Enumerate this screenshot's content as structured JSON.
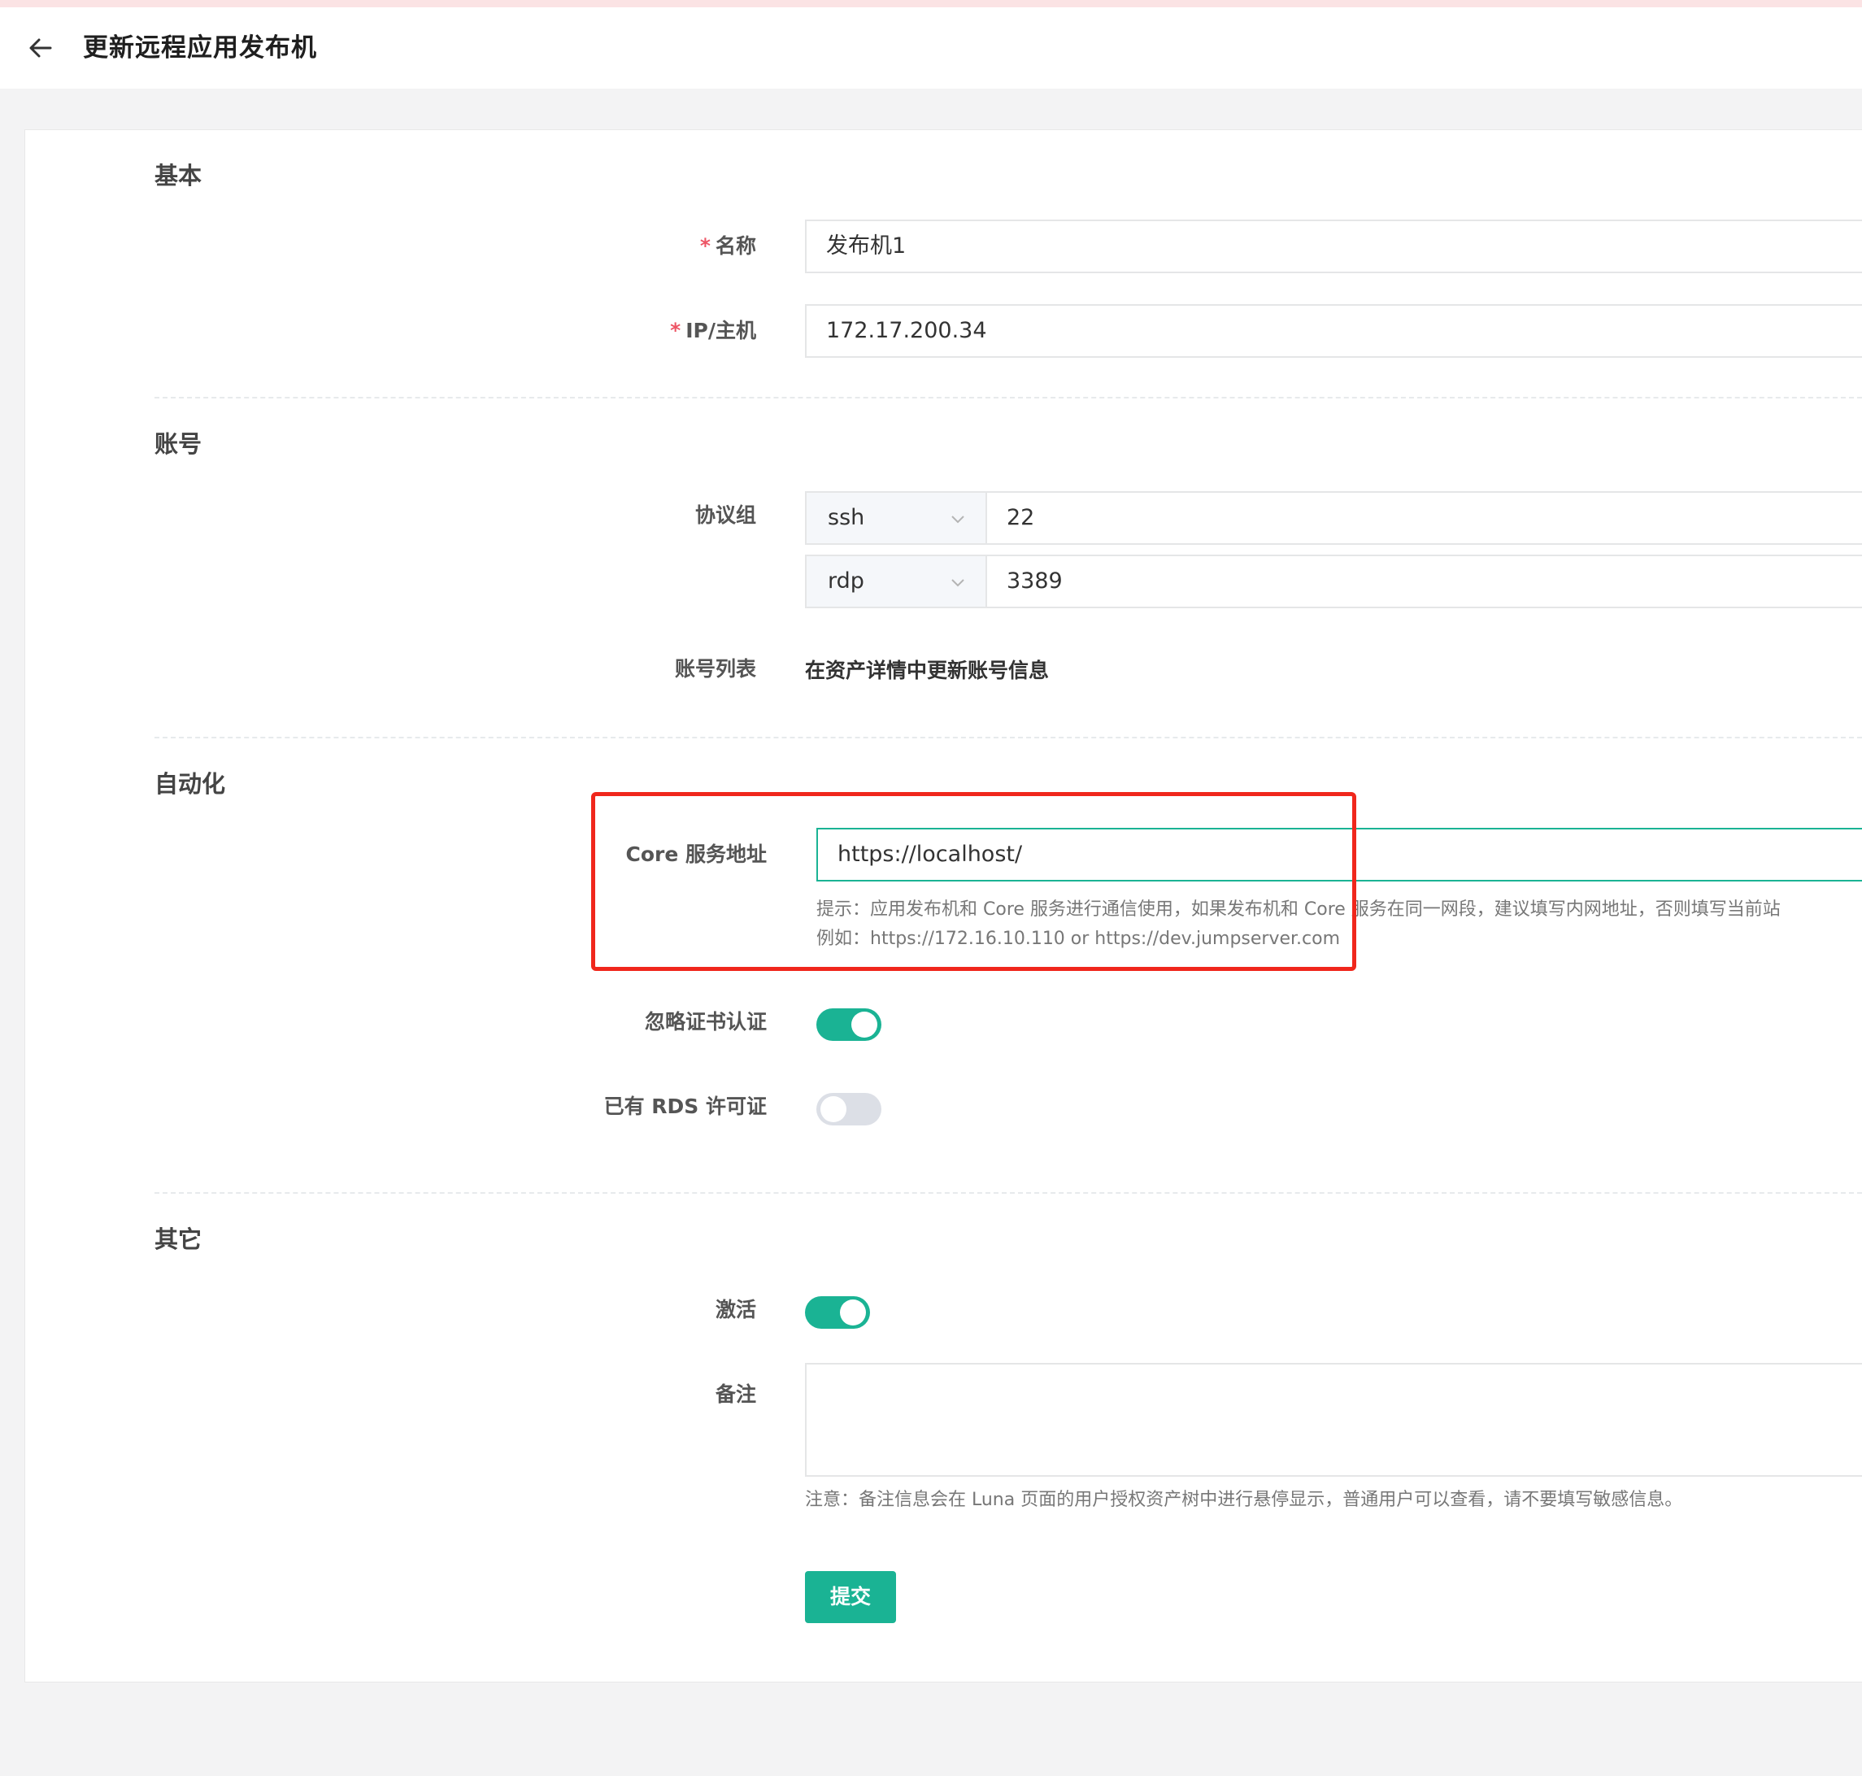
{
  "header": {
    "title": "更新远程应用发布机"
  },
  "sections": {
    "basic": "基本",
    "account": "账号",
    "automation": "自动化",
    "other": "其它"
  },
  "basic": {
    "name_label": "名称",
    "name_value": "发布机1",
    "ip_label": "IP/主机",
    "ip_value": "172.17.200.34",
    "required_mark": "*"
  },
  "account": {
    "protocol_label": "协议组",
    "protocols": [
      {
        "name": "ssh",
        "port": "22"
      },
      {
        "name": "rdp",
        "port": "3389"
      }
    ],
    "list_label": "账号列表",
    "list_text": "在资产详情中更新账号信息"
  },
  "automation": {
    "core_label": "Core 服务地址",
    "core_value": "https://localhost/",
    "hint_line1": "提示：应用发布机和 Core 服务进行通信使用，如果发布机和 Core 服务在同一网段，建议填写内网地址，否则填写当前站",
    "hint_line2": "例如：https://172.16.10.110 or https://dev.jumpserver.com",
    "ignore_cert_label": "忽略证书认证",
    "ignore_cert_on": true,
    "rds_label": "已有 RDS 许可证",
    "rds_on": false
  },
  "other": {
    "active_label": "激活",
    "active_on": true,
    "comment_label": "备注",
    "comment_value": "",
    "comment_hint": "注意：备注信息会在 Luna 页面的用户授权资产树中进行悬停显示，普通用户可以查看，请不要填写敏感信息。"
  },
  "actions": {
    "submit_label": "提交"
  },
  "colors": {
    "accent": "#1ab394",
    "required": "#ed5565",
    "highlight": "#f0271c"
  }
}
